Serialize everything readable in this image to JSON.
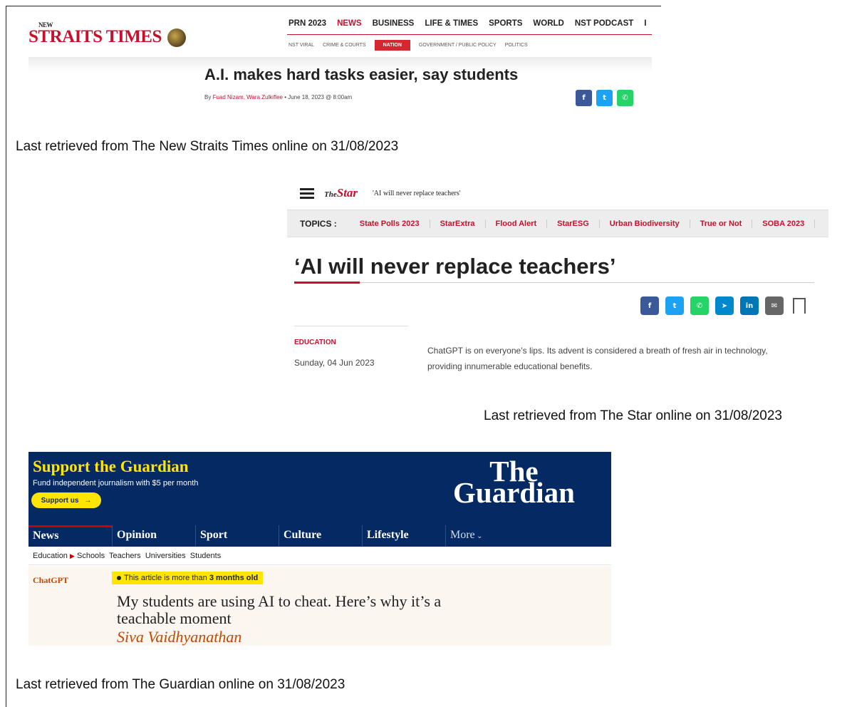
{
  "nst": {
    "logo_new": "NEW",
    "logo": "STRAITS TIMES",
    "nav": [
      "PRN 2023",
      "NEWS",
      "BUSINESS",
      "LIFE & TIMES",
      "SPORTS",
      "WORLD",
      "NST PODCAST",
      "I"
    ],
    "nav_active": "NEWS",
    "subnav": [
      "NST VIRAL",
      "CRIME & COURTS",
      "NATION",
      "GOVERNMENT / PUBLIC POLICY",
      "POLITICS"
    ],
    "subnav_active": "NATION",
    "title": "A.I. makes hard tasks easier, say students",
    "byline_prefix": "By ",
    "byline_authors": "Fuad Nizam, Wara Zulkiflee",
    "byline_date": " • June 18, 2023 @ 8:00am",
    "share": [
      {
        "icon": "facebook-icon",
        "glyph": "f",
        "color": "#3b5998"
      },
      {
        "icon": "twitter-icon",
        "glyph": "t",
        "color": "#1da1f2"
      },
      {
        "icon": "whatsapp-icon",
        "glyph": "✆",
        "color": "#25d366"
      }
    ]
  },
  "nst_caption": "Last retrieved from The New Straits Times online on 31/08/2023",
  "star": {
    "logo_the": "The",
    "logo": "Star",
    "crumb": "'AI will never replace teachers'",
    "topics_label": "TOPICS :",
    "topics": [
      "State Polls 2023",
      "StarExtra",
      "Flood Alert",
      "StarESG",
      "Urban Biodiversity",
      "True or Not",
      "SOBA 2023"
    ],
    "title": "‘AI will never replace teachers’",
    "share": [
      {
        "icon": "facebook-icon",
        "glyph": "f",
        "color": "#3b5998"
      },
      {
        "icon": "twitter-icon",
        "glyph": "t",
        "color": "#1da1f2"
      },
      {
        "icon": "whatsapp-icon",
        "glyph": "✆",
        "color": "#25d366"
      },
      {
        "icon": "telegram-icon",
        "glyph": "➤",
        "color": "#0088cc"
      },
      {
        "icon": "linkedin-icon",
        "glyph": "in",
        "color": "#0077b5"
      },
      {
        "icon": "email-icon",
        "glyph": "✉",
        "color": "#666666"
      }
    ],
    "category": "EDUCATION",
    "date": "Sunday, 04 Jun 2023",
    "lede": "ChatGPT is on everyone’s lips. Its advent is considered a breath of fresh air in technology, providing innumerable educational benefits."
  },
  "star_caption": "Last retrieved from The Star online on 31/08/2023",
  "guardian": {
    "support_title": "Support the Guardian",
    "support_sub": "Fund independent journalism with $5 per month",
    "support_button": "Support us",
    "logo_line1": "The",
    "logo_line2": "Guardian",
    "nav": [
      "News",
      "Opinion",
      "Sport",
      "Culture",
      "Lifestyle",
      "More"
    ],
    "subnav_section": "Education",
    "subnav": [
      "Schools",
      "Teachers",
      "Universities",
      "Students"
    ],
    "tag": "ChatGPT",
    "badge_prefix": "This article is more than ",
    "badge_bold": "3 months old",
    "headline": "My students are using AI to cheat. Here’s why it’s a teachable moment",
    "author": "Siva Vaidhyanathan",
    "colors": {
      "navy": "#052962",
      "yellow": "#ffe500",
      "opinion": "#c74600"
    }
  },
  "guardian_caption": "Last retrieved from The Guardian online on 31/08/2023"
}
